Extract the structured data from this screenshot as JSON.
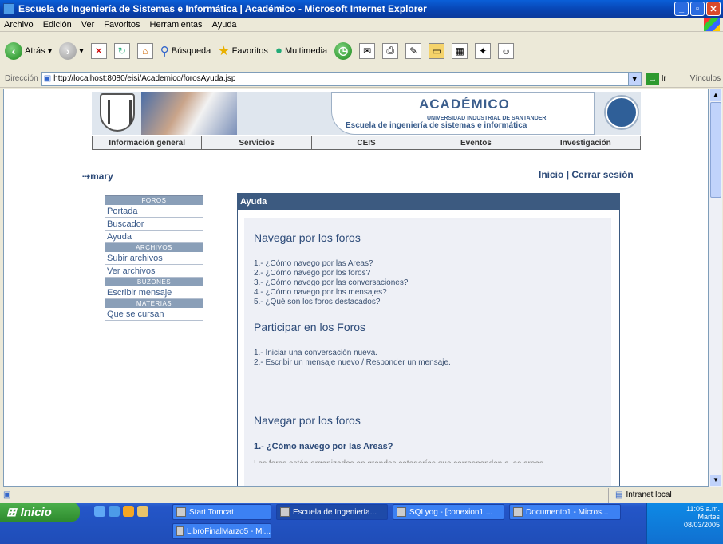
{
  "window": {
    "title": "Escuela de Ingeniería de Sistemas e Informática | Académico - Microsoft Internet Explorer"
  },
  "menu": [
    "Archivo",
    "Edición",
    "Ver",
    "Favoritos",
    "Herramientas",
    "Ayuda"
  ],
  "toolbar": {
    "back": "Atrás",
    "search": "Búsqueda",
    "favorites": "Favoritos",
    "media": "Multimedia"
  },
  "address": {
    "label": "Dirección",
    "url": "http://localhost:8080/eisi/Academico/forosAyuda.jsp",
    "go": "Ir",
    "links": "Vínculos"
  },
  "header": {
    "academico": "ACADÉMICO",
    "university": "UNIVERSIDAD INDUSTRIAL DE SANTANDER",
    "school": "Escuela de ingeniería de sistemas e informática"
  },
  "nav": [
    "Información general",
    "Servicios",
    "CEIS",
    "Eventos",
    "Investigación"
  ],
  "user": {
    "name": "mary",
    "home": "Inicio",
    "sep": "|",
    "logout": "Cerrar sesión"
  },
  "sidebar": {
    "foros_title": "FOROS",
    "foros": [
      "Portada",
      "Buscador",
      "Ayuda"
    ],
    "archivos_title": "ARCHIVOS",
    "archivos": [
      "Subir archivos",
      "Ver archivos"
    ],
    "buzones_title": "BUZONES",
    "buzones": [
      "Escribir mensaje"
    ],
    "materias_title": "MATERIAS",
    "materias": [
      "Que se cursan"
    ]
  },
  "panel": {
    "title": "Ayuda",
    "section1": "Navegar por los foros",
    "q1": [
      "1.- ¿Cómo navego por las Areas?",
      "2.- ¿Cómo navego por los foros?",
      "3.- ¿Cómo navego por las conversaciones?",
      "4.- ¿Cómo navego por los mensajes?",
      "5.- ¿Qué son los foros destacados?"
    ],
    "section2": "Participar en los Foros",
    "q2": [
      "1.- Iniciar una conversación nueva.",
      "2.- Escribir un mensaje nuevo / Responder un mensaje."
    ],
    "section3": "Navegar por los foros",
    "subheading": "1.- ¿Cómo navego por las Areas?",
    "cut_text": "Los foros están organizados en grandes categorías que corresponden a las areas"
  },
  "status": {
    "zone": "Intranet local"
  },
  "taskbar": {
    "start": "Inicio",
    "tasks": [
      "Start Tomcat",
      "Escuela de Ingeniería...",
      "SQLyog - [conexion1 ...",
      "Documento1 - Micros...",
      "LibroFinalMarzo5 - Mi..."
    ],
    "time": "11:05 a.m.",
    "day": "Martes",
    "date": "08/03/2005"
  }
}
